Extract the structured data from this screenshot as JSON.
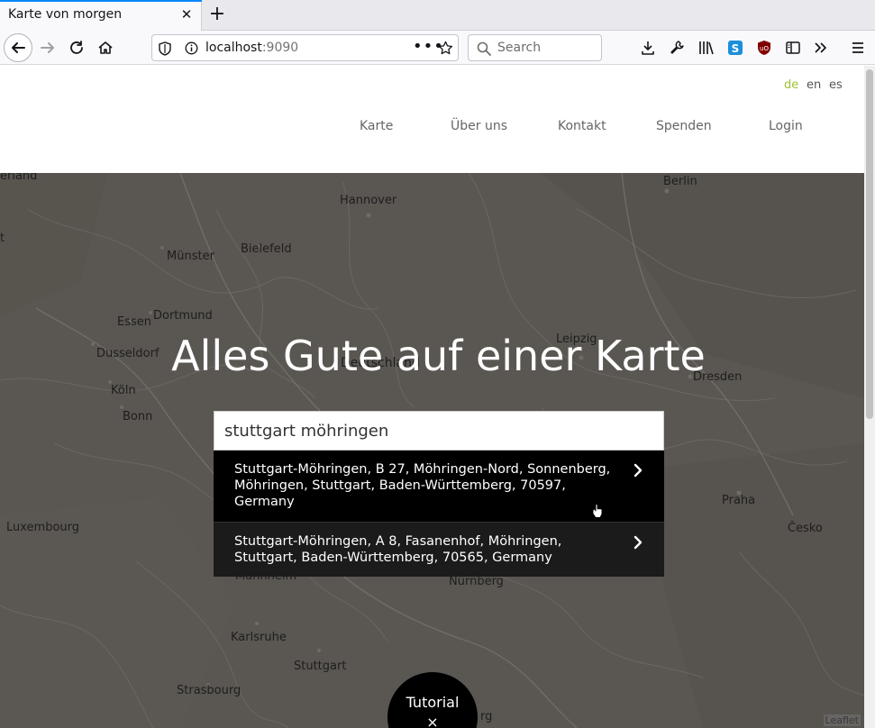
{
  "browser": {
    "tab_title": "Karte von morgen",
    "tab_close_icon": "close-icon",
    "new_tab_icon": "plus-icon",
    "url_host": "localhost",
    "url_port": ":9090",
    "search_placeholder": "Search",
    "accent_color": "#0a84ff"
  },
  "header": {
    "languages": [
      "de",
      "en",
      "es"
    ],
    "active_language": "de",
    "active_language_color": "#9ec235",
    "menu": [
      "Karte",
      "Über uns",
      "Kontakt",
      "Spenden",
      "Login"
    ]
  },
  "map": {
    "cities": [
      "erland",
      "Hannover",
      "Berlin",
      "Münster",
      "Bielefeld",
      "Essen",
      "Dortmund",
      "Dusseldorf",
      "Leipzig",
      "Deutschland",
      "Dresden",
      "Köln",
      "Bonn",
      "Praha",
      "Luxembourg",
      "Česko",
      "Mannheim",
      "Nürnberg",
      "Karlsruhe",
      "Stuttgart",
      "Strasbourg",
      "rg",
      "t"
    ],
    "hero_title": "Alles Gute auf einer Karte",
    "search_value": "stuttgart möhringen",
    "results": [
      "Stuttgart-Möhringen, B 27, Möhringen-Nord, Sonnenberg, Möhringen, Stuttgart, Baden-Württemberg, 70597, Germany",
      "Stuttgart-Möhringen, A 8, Fasanenhof, Möhringen, Stuttgart, Baden-Württemberg, 70565, Germany"
    ],
    "result_icon": "chevron-right-icon",
    "tutorial_label": "Tutorial",
    "tutorial_close": "×",
    "attribution": "Leaflet"
  }
}
